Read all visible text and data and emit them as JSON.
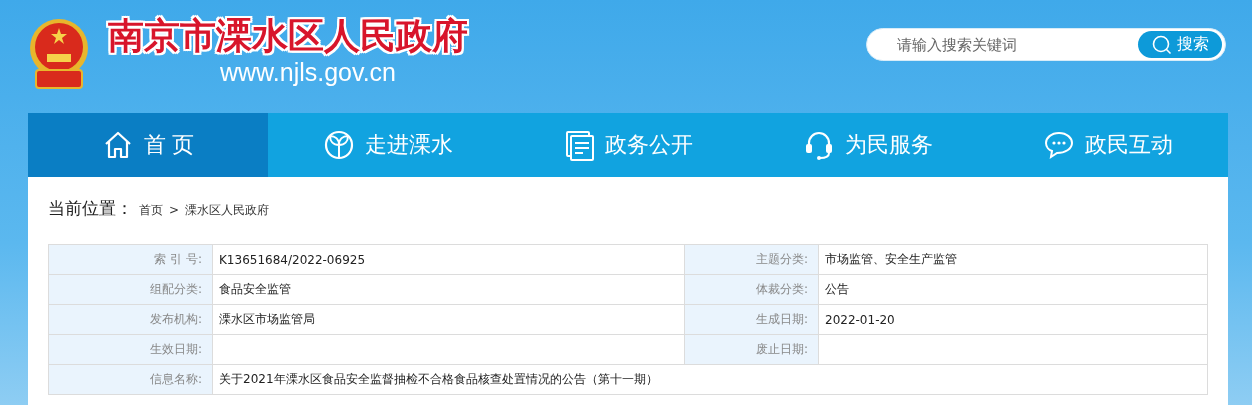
{
  "header": {
    "site_title": "南京市溧水区人民政府",
    "site_url": "www.njls.gov.cn",
    "search": {
      "placeholder": "请输入搜索关键词",
      "button": "搜索"
    }
  },
  "nav": [
    {
      "label": "首 页",
      "selected": true
    },
    {
      "label": "走进溧水",
      "selected": false
    },
    {
      "label": "政务公开",
      "selected": false
    },
    {
      "label": "为民服务",
      "selected": false
    },
    {
      "label": "政民互动",
      "selected": false
    }
  ],
  "breadcrumb": {
    "label": "当前位置：",
    "items": [
      "首页",
      "溧水区人民政府"
    ],
    "separator": ">"
  },
  "info_table": [
    {
      "cells": [
        {
          "label": "索 引 号:",
          "value": "K13651684/2022-06925"
        },
        {
          "label": "主题分类:",
          "value": "市场监管、安全生产监管"
        }
      ]
    },
    {
      "cells": [
        {
          "label": "组配分类:",
          "value": "食品安全监管"
        },
        {
          "label": "体裁分类:",
          "value": "公告"
        }
      ]
    },
    {
      "cells": [
        {
          "label": "发布机构:",
          "value": "溧水区市场监管局"
        },
        {
          "label": "生成日期:",
          "value": "2022-01-20"
        }
      ]
    },
    {
      "cells": [
        {
          "label": "生效日期:"
        },
        {
          "label": "废止日期:"
        }
      ]
    },
    {
      "cells": [
        {
          "label": "信息名称:",
          "value": "关于2021年溧水区食品安全监督抽检不合格食品核查处置情况的公告（第十一期）"
        }
      ]
    }
  ]
}
